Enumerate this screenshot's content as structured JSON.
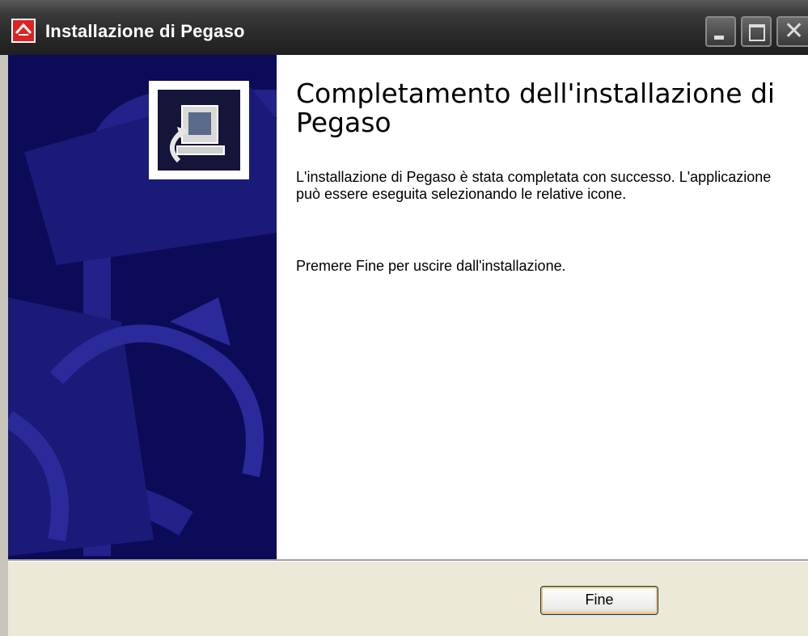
{
  "window": {
    "title": "Installazione di Pegaso"
  },
  "content": {
    "heading": "Completamento dell'installazione di Pegaso",
    "paragraph1": "L'installazione di Pegaso è stata completata con successo. L'applicazione può essere eseguita selezionando le relative icone.",
    "paragraph2": "Premere Fine per uscire dall'installazione."
  },
  "footer": {
    "finish_label": "Fine"
  },
  "colors": {
    "banner": "#0b0b57",
    "banner_shapes": "#22228a"
  },
  "icons": {
    "app": "pegaso-app-icon",
    "banner": "computer-install-icon"
  }
}
